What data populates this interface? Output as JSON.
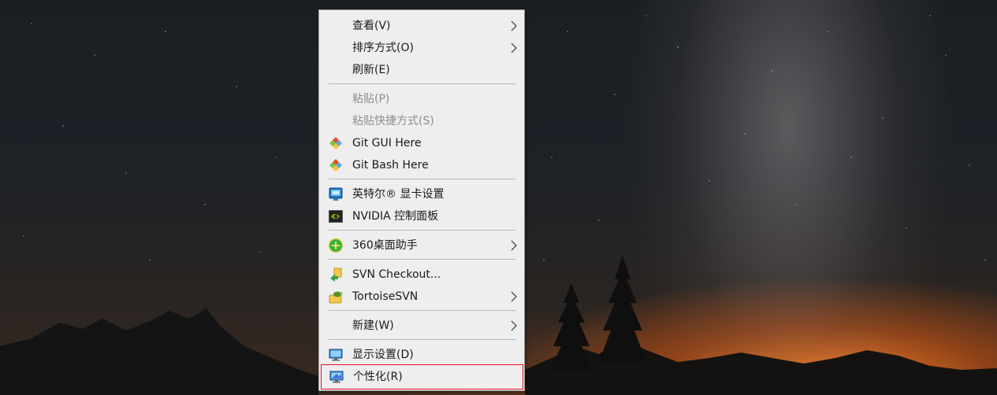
{
  "context_menu": {
    "items": [
      {
        "label": "查看(V)",
        "icon": "",
        "submenu": true,
        "enabled": true
      },
      {
        "label": "排序方式(O)",
        "icon": "",
        "submenu": true,
        "enabled": true
      },
      {
        "label": "刷新(E)",
        "icon": "",
        "submenu": false,
        "enabled": true
      },
      {
        "label": "粘贴(P)",
        "icon": "",
        "submenu": false,
        "enabled": false
      },
      {
        "label": "粘贴快捷方式(S)",
        "icon": "",
        "submenu": false,
        "enabled": false
      },
      {
        "label": "Git GUI Here",
        "icon": "git-icon",
        "submenu": false,
        "enabled": true
      },
      {
        "label": "Git Bash Here",
        "icon": "git-icon",
        "submenu": false,
        "enabled": true
      },
      {
        "label": "英特尔® 显卡设置",
        "icon": "intel-graphics-icon",
        "submenu": false,
        "enabled": true
      },
      {
        "label": "NVIDIA 控制面板",
        "icon": "nvidia-icon",
        "submenu": false,
        "enabled": true
      },
      {
        "label": "360桌面助手",
        "icon": "360-desktop-icon",
        "submenu": true,
        "enabled": true
      },
      {
        "label": "SVN Checkout...",
        "icon": "svn-checkout-icon",
        "submenu": false,
        "enabled": true
      },
      {
        "label": "TortoiseSVN",
        "icon": "tortoisesvn-icon",
        "submenu": true,
        "enabled": true
      },
      {
        "label": "新建(W)",
        "icon": "",
        "submenu": true,
        "enabled": true
      },
      {
        "label": "显示设置(D)",
        "icon": "display-settings-icon",
        "submenu": false,
        "enabled": true
      },
      {
        "label": "个性化(R)",
        "icon": "personalize-icon",
        "submenu": false,
        "enabled": true,
        "highlighted": true
      }
    ]
  },
  "colors": {
    "menu_background": "#eeeeee",
    "highlight_border": "#e81123",
    "disabled_text": "#8d8d8d"
  }
}
